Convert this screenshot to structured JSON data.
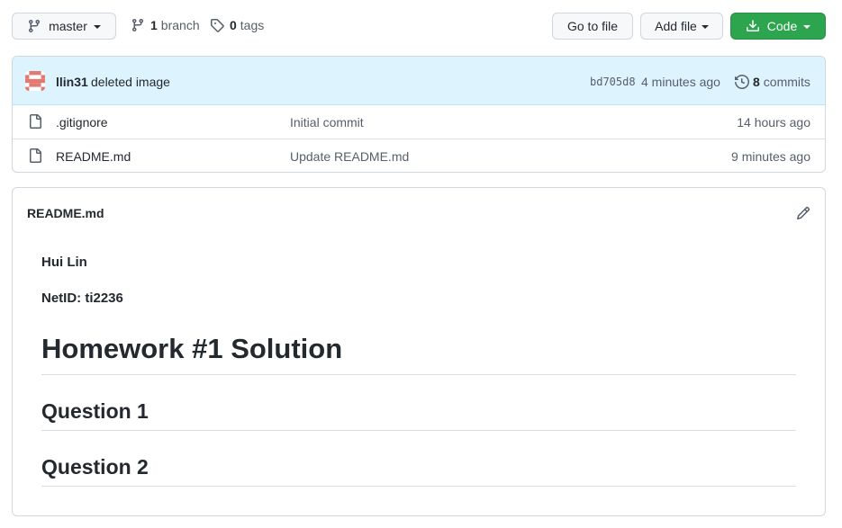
{
  "toolbar": {
    "branch_selector": "master",
    "branches_count": "1",
    "branches_label": "branch",
    "tags_count": "0",
    "tags_label": "tags",
    "go_to_file": "Go to file",
    "add_file": "Add file",
    "code": "Code"
  },
  "latest_commit": {
    "author": "llin31",
    "message": "deleted image",
    "sha": "bd705d8",
    "time": "4 minutes ago",
    "commits_count": "8",
    "commits_label": "commits"
  },
  "files": [
    {
      "name": ".gitignore",
      "message": "Initial commit",
      "time": "14 hours ago"
    },
    {
      "name": "README.md",
      "message": "Update README.md",
      "time": "9 minutes ago"
    }
  ],
  "readme": {
    "filename": "README.md",
    "line1": "Hui Lin",
    "line2": "NetID: ti2236",
    "h1": "Homework #1 Solution",
    "h2a": "Question 1",
    "h2b": "Question 2"
  },
  "colors": {
    "primary_button": "#2da44e",
    "commit_bar": "#ddf4ff",
    "border": "#d0d7de"
  }
}
